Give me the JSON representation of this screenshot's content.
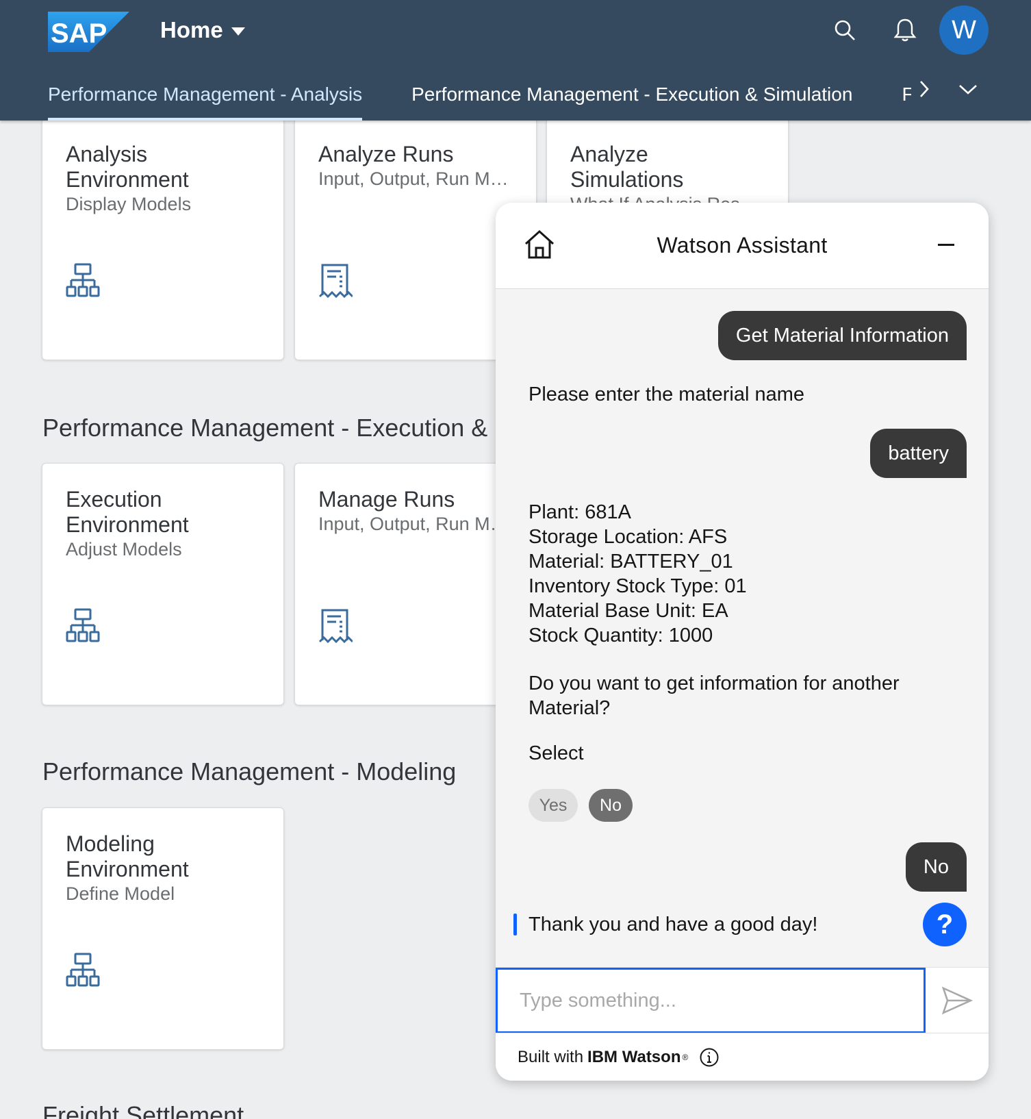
{
  "shell": {
    "logo_text": "SAP",
    "home_label": "Home",
    "avatar_initial": "W",
    "tabs": [
      "Performance Management - Analysis",
      "Performance Management - Execution & Simulation",
      "F"
    ],
    "icons": [
      "search-icon",
      "bell-icon",
      "chevron-right-icon",
      "chevron-down-icon"
    ]
  },
  "tiles": [
    {
      "title_line1": "Analysis",
      "title_line2": "Environment",
      "subtitle": "Display Models",
      "icon": "hierarchy-icon"
    },
    {
      "title_line1": "Analyze Runs",
      "title_line2": "",
      "subtitle": "Input, Output, Run Monitor",
      "icon": "receipt-icon"
    },
    {
      "title_line1": "Analyze",
      "title_line2": "Simulations",
      "subtitle": "What If Analysis Res",
      "icon": ""
    },
    {
      "title_line1": "Execution",
      "title_line2": "Environment",
      "subtitle": "Adjust Models",
      "icon": "hierarchy-icon"
    },
    {
      "title_line1": "Manage Runs",
      "title_line2": "",
      "subtitle": "Input, Output, Run Monitor",
      "icon": "receipt-icon"
    },
    {
      "title_line1": "Modeling",
      "title_line2": "Environment",
      "subtitle": "Define Model",
      "icon": "hierarchy-icon"
    }
  ],
  "groups": {
    "execution": "Performance Management - Execution & Simulation",
    "modeling": "Performance Management - Modeling",
    "freight": "Freight Settlement"
  },
  "watson": {
    "title": "Watson Assistant",
    "user_msg_1": "Get Material Information",
    "bot_msg_1": "Please enter the material name",
    "user_msg_2": "battery",
    "bot_details": [
      "Plant: 681A",
      "Storage Location: AFS",
      "Material: BATTERY_01",
      "Inventory Stock Type: 01",
      "Material Base Unit: EA",
      "Stock Quantity: 1000"
    ],
    "bot_question": "Do you want to get information for another Material?",
    "select_label": "Select",
    "option_yes": "Yes",
    "option_no": "No",
    "user_msg_3": "No",
    "bot_msg_final": "Thank you and have a good day!",
    "help_label": "?",
    "input_placeholder": "Type something...",
    "footer_built": "Built with",
    "footer_brand": "IBM Watson",
    "footer_reg": "®"
  },
  "colors": {
    "shell_bg": "#354a5f",
    "accent_blue": "#0f62fe",
    "user_bubble": "#393939",
    "tile_icon": "#3a6b9c"
  }
}
